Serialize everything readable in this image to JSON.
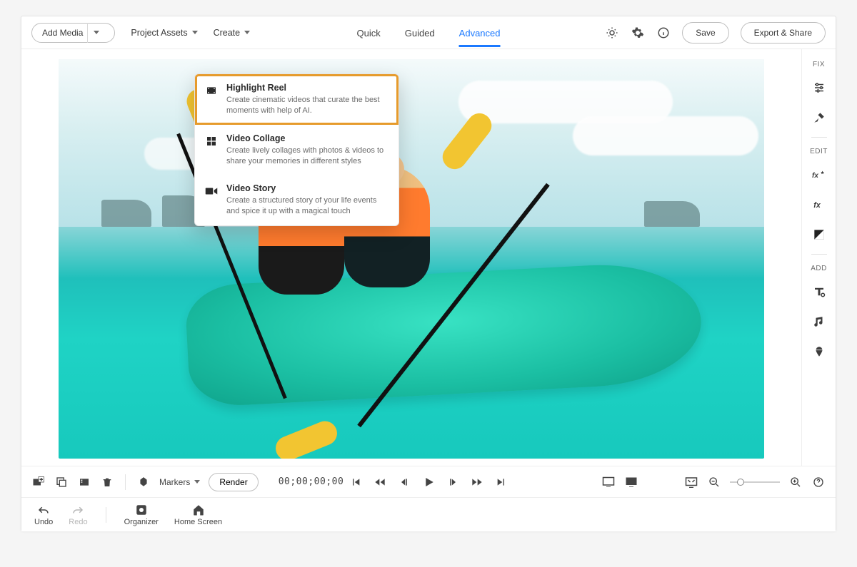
{
  "topbar": {
    "add_media": "Add Media",
    "project_assets": "Project Assets",
    "create": "Create",
    "save": "Save",
    "export_share": "Export & Share"
  },
  "tabs": {
    "quick": "Quick",
    "guided": "Guided",
    "advanced": "Advanced",
    "active": "advanced"
  },
  "create_menu": {
    "items": [
      {
        "title": "Highlight Reel",
        "desc": "Create cinematic videos that curate the best moments with help of AI."
      },
      {
        "title": "Video Collage",
        "desc": "Create lively collages with photos & videos to share your memories in different styles"
      },
      {
        "title": "Video Story",
        "desc": "Create a structured story of your life events and spice it up with a magical touch"
      }
    ]
  },
  "rail": {
    "fix": "FIX",
    "edit": "EDIT",
    "add": "ADD"
  },
  "ctrl": {
    "markers": "Markers",
    "render": "Render",
    "timecode": "00;00;00;00"
  },
  "footer": {
    "undo": "Undo",
    "redo": "Redo",
    "organizer": "Organizer",
    "home": "Home Screen"
  }
}
